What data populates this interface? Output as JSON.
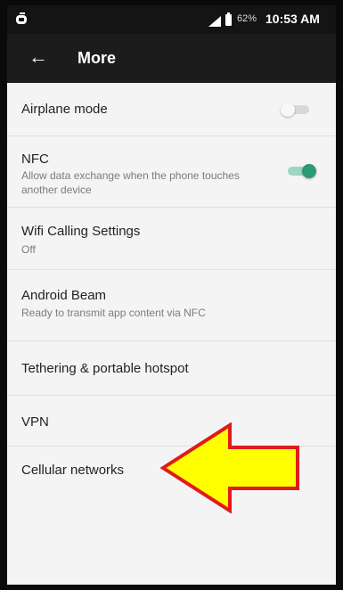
{
  "status_bar": {
    "battery_percent": "62%",
    "time": "10:53 AM"
  },
  "toolbar": {
    "title": "More",
    "back_icon": "arrow-back-icon"
  },
  "items": [
    {
      "title": "Airplane mode",
      "subtitle": "",
      "toggle": "off"
    },
    {
      "title": "NFC",
      "subtitle": "Allow data exchange when the phone touches another device",
      "toggle": "on"
    },
    {
      "title": "Wifi Calling Settings",
      "subtitle": "Off"
    },
    {
      "title": "Android Beam",
      "subtitle": "Ready to transmit app content via NFC"
    },
    {
      "title": "Tethering & portable hotspot",
      "subtitle": ""
    },
    {
      "title": "VPN",
      "subtitle": ""
    },
    {
      "title": "Cellular networks",
      "subtitle": ""
    }
  ],
  "annotation": {
    "icon": "yellow-arrow-icon",
    "fill": "#ffff00",
    "stroke": "#e01b1b"
  },
  "colors": {
    "accent": "#2a9a73",
    "toolbar": "#1c1c1c",
    "background": "#f4f4f4"
  }
}
